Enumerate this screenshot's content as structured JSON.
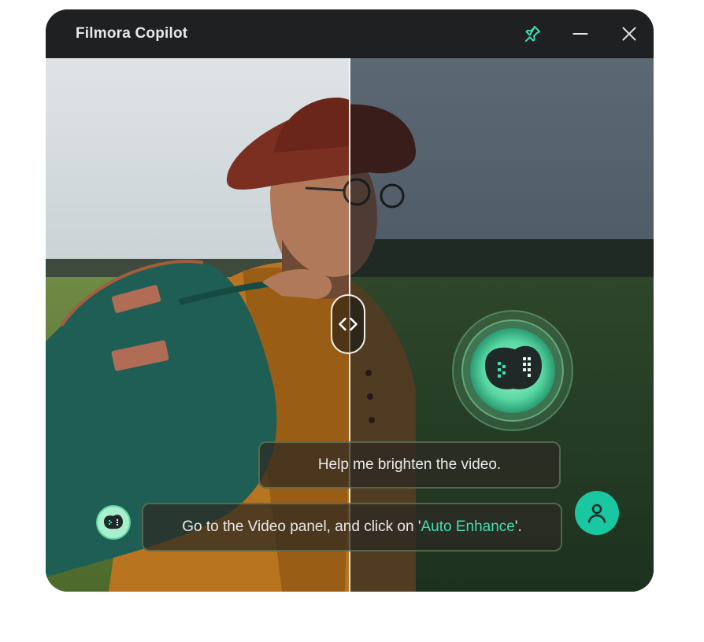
{
  "window": {
    "title": "Filmora Copilot"
  },
  "titlebar": {
    "pin_icon": "pin-icon",
    "minimize_icon": "minimize-icon",
    "close_icon": "close-icon"
  },
  "compare": {
    "handle_icon": "compare-arrows-icon"
  },
  "chat": {
    "user_message": "Help me brighten the video.",
    "bot_message_prefix": "Go to the Video panel, and click on '",
    "bot_message_highlight": "Auto Enhance",
    "bot_message_suffix": "'."
  },
  "colors": {
    "accent": "#3fe0b2",
    "user_avatar": "#19c7a2",
    "titlebar": "#1e2022"
  }
}
